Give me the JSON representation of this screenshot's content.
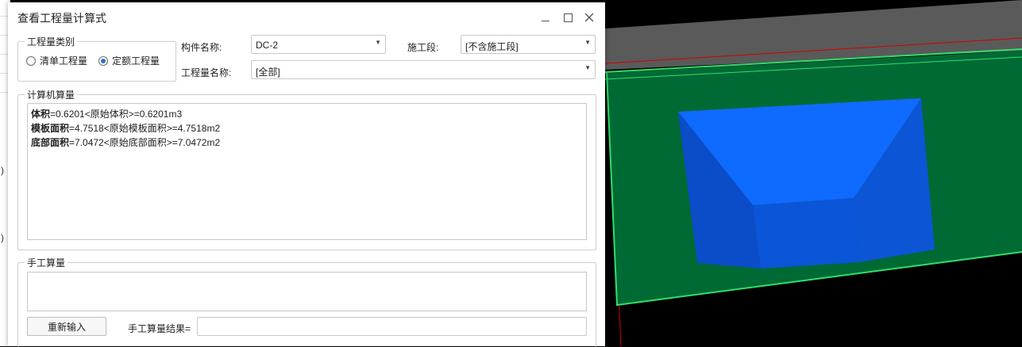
{
  "dialog": {
    "title": "查看工程量计算式",
    "minimize_icon": "minimize-icon",
    "maximize_icon": "maximize-icon",
    "close_icon": "close-icon"
  },
  "left_marks": [
    ")",
    ")"
  ],
  "category": {
    "legend": "工程量类别",
    "options": [
      {
        "label": "清单工程量",
        "checked": false
      },
      {
        "label": "定额工程量",
        "checked": true
      }
    ]
  },
  "component": {
    "label": "构件名称:",
    "value": "DC-2"
  },
  "section": {
    "label": "施工段:",
    "value": "[不含施工段]"
  },
  "quantity_name": {
    "label": "工程量名称:",
    "value": "[全部]"
  },
  "computer_calc": {
    "legend": "计算机算量",
    "lines": [
      {
        "name": "体积",
        "expr": "=0.6201<原始体积>=0.6201m3"
      },
      {
        "name": "模板面积",
        "expr": "=4.7518<原始模板面积>=4.7518m2"
      },
      {
        "name": "底部面积",
        "expr": "=7.0472<原始底部面积>=7.0472m2"
      }
    ]
  },
  "manual_calc": {
    "legend": "手工算量",
    "reenter_button": "重新输入",
    "result_label": "手工算量结果=",
    "result_value": ""
  },
  "viewport_colors": {
    "background": "#000000",
    "top_plane": "#5a5a5a",
    "base_plate": "#006a35",
    "edge": "#2ee06a",
    "solid_top": "#0a68f5",
    "solid_side": "#0a4fd0",
    "axis_red": "#d40000"
  }
}
